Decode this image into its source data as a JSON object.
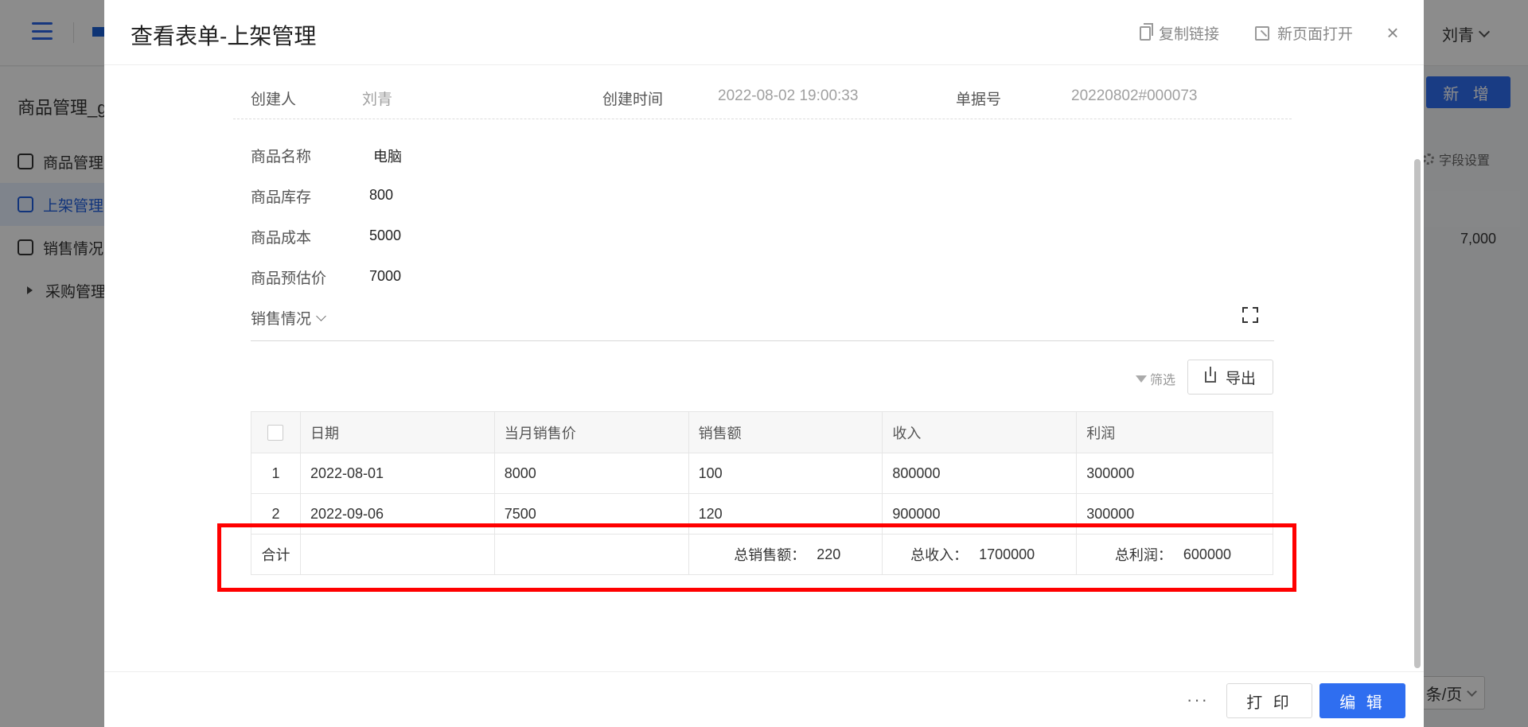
{
  "background": {
    "app_title": "商品管理_g",
    "user_name": "刘青",
    "new_button": "新 增",
    "field_settings": "字段设置",
    "nav": [
      {
        "label": "商品管理"
      },
      {
        "label": "上架管理"
      },
      {
        "label": "销售情况"
      },
      {
        "label": "采购管理"
      }
    ],
    "row_value": "7,000",
    "page_size": "条/页"
  },
  "modal": {
    "title": "查看表单-上架管理",
    "copy_link": "复制链接",
    "open_new_page": "新页面打开",
    "close": "×",
    "meta": {
      "creator_label": "创建人",
      "creator_value": "刘青",
      "created_time_label": "创建时间",
      "created_time_value": "2022-08-02 19:00:33",
      "doc_no_label": "单据号",
      "doc_no_value": "20220802#000073"
    },
    "fields": [
      {
        "label": "商品名称",
        "value": "电脑"
      },
      {
        "label": "商品库存",
        "value": "800"
      },
      {
        "label": "商品成本",
        "value": "5000"
      },
      {
        "label": "商品预估价",
        "value": "7000"
      }
    ],
    "section_title": "销售情况",
    "filter": "筛选",
    "export": "导出",
    "table": {
      "columns": [
        "日期",
        "当月销售价",
        "销售额",
        "收入",
        "利润"
      ],
      "rows": [
        {
          "index": "1",
          "date": "2022-08-01",
          "price": "8000",
          "sales": "100",
          "income": "800000",
          "profit": "300000"
        },
        {
          "index": "2",
          "date": "2022-09-06",
          "price": "7500",
          "sales": "120",
          "income": "900000",
          "profit": "300000"
        }
      ],
      "summary": {
        "label": "合计",
        "total_sales_label": "总销售额：",
        "total_sales_value": "220",
        "total_income_label": "总收入：",
        "total_income_value": "1700000",
        "total_profit_label": "总利润：",
        "total_profit_value": "600000"
      }
    },
    "footer": {
      "more": "···",
      "print": "打 印",
      "edit": "编 辑"
    }
  },
  "colors": {
    "accent": "#2f6ef0",
    "highlight": "#ff0000"
  }
}
